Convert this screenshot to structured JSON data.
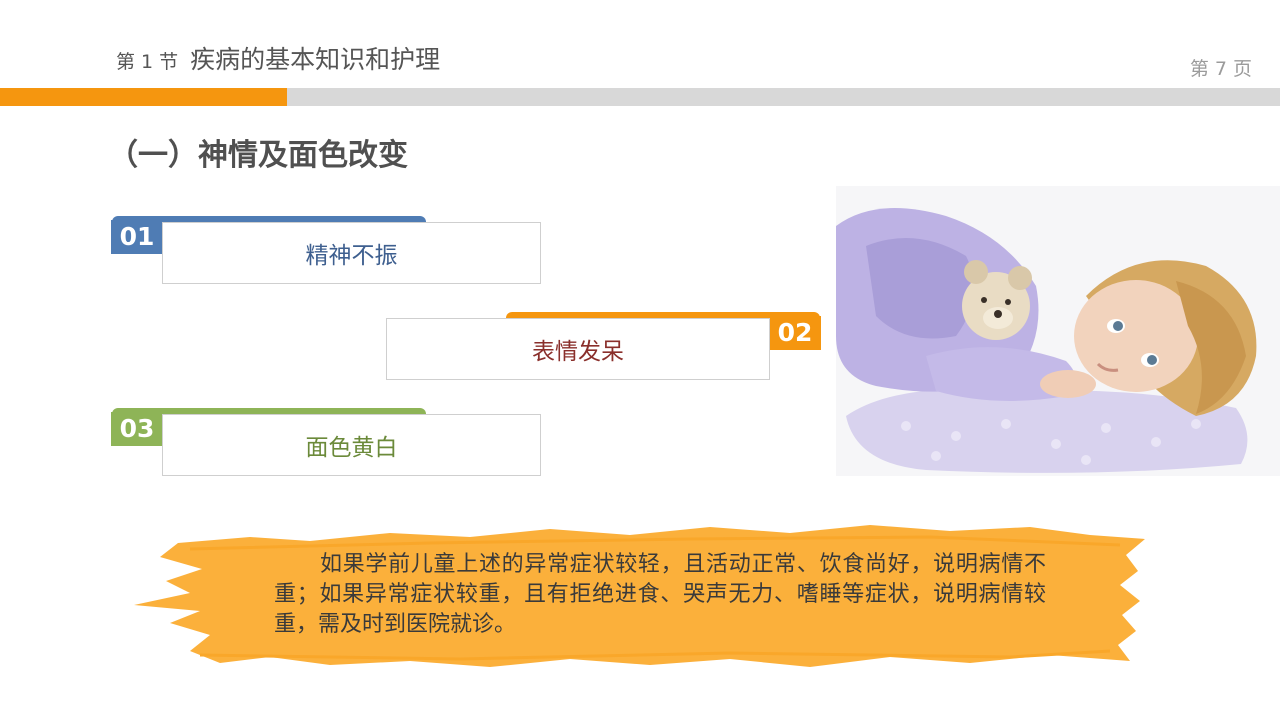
{
  "header": {
    "section_number": "第 1 节",
    "section_title": "疾病的基本知识和护理",
    "page_label": "第 7 页"
  },
  "heading": "（一）神情及面色改变",
  "items": [
    {
      "number": "01",
      "label": "精神不振",
      "color": "#4f7cb4",
      "text_color": "#3e5f8f"
    },
    {
      "number": "02",
      "label": "表情发呆",
      "color": "#f5960f",
      "text_color": "#8a2f2b"
    },
    {
      "number": "03",
      "label": "面色黄白",
      "color": "#8eb457",
      "text_color": "#6b8a3a"
    }
  ],
  "note": "如果学前儿童上述的异常症状较轻，且活动正常、饮食尚好，说明病情不重；如果异常症状较重，且有拒绝进食、哭声无力、嗜睡等症状，说明病情较重，需及时到医院就诊。",
  "colors": {
    "accent_orange": "#f5960f",
    "bar_gray": "#d8d8d8",
    "brush_fill": "#fbb03b"
  }
}
